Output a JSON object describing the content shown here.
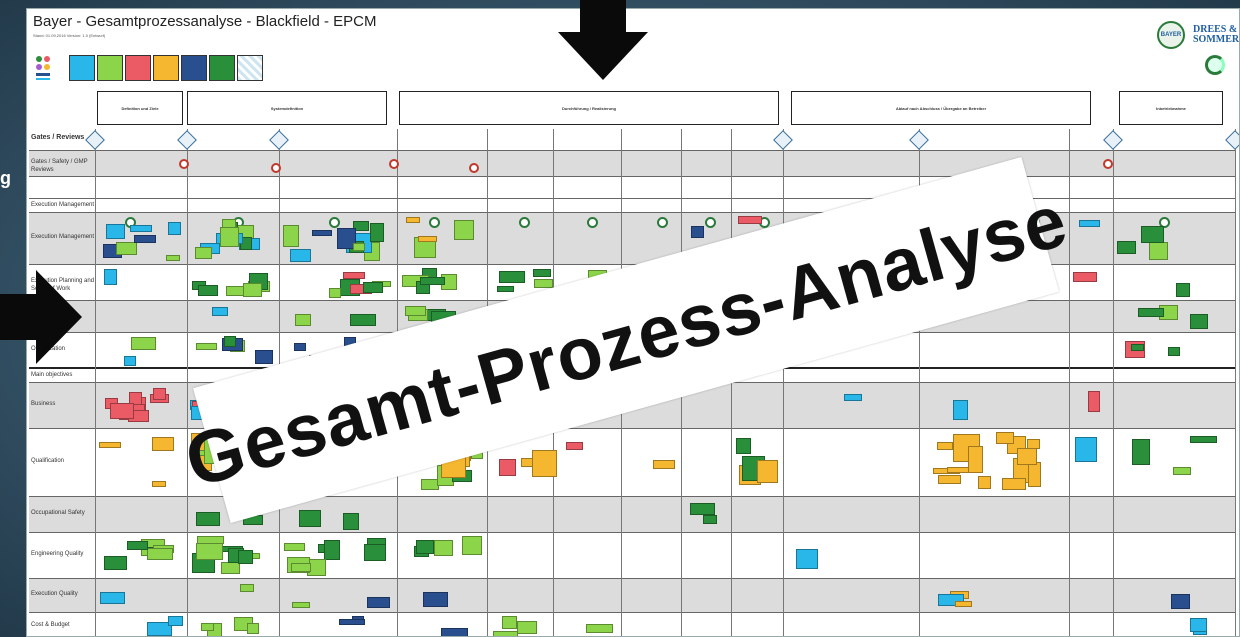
{
  "left_fragment": "g",
  "poster": {
    "title": "Bayer - Gesamtprozessanalyse - Blackfield - EPCM",
    "subtitle": "Stand: 01.09.2016 Version: 1.0 (Entwurf)",
    "legend_colors": [
      "#29b6e8",
      "#8cd44a",
      "#ea5b66",
      "#f5b730",
      "#2a4f8f",
      "#2a8f3a"
    ],
    "phases": [
      "Definition und Ziele",
      "Systemdefinition",
      "Durchführung / Realisierung",
      "Ablauf nach Abschluss / Übergabe an Betreiber",
      "Inbetriebnahme"
    ],
    "rows": [
      {
        "label": "Gates / Reviews"
      },
      {
        "label": "Gates / Safety / GMP Reviews"
      },
      {
        "label": ""
      },
      {
        "label": "Execution Management"
      },
      {
        "label": "Execution Management"
      },
      {
        "label": "Execution Planning and Scope of Work"
      },
      {
        "label": ""
      },
      {
        "label": "Organization"
      },
      {
        "label": "Main objectives"
      },
      {
        "label": "Business"
      },
      {
        "label": "Qualification"
      },
      {
        "label": "Occupational Safety"
      },
      {
        "label": "Engineering Quality"
      },
      {
        "label": "Execution Quality"
      },
      {
        "label": "Cost & Budget"
      }
    ],
    "logo_bayer": "BAYER",
    "logo_ds": "DREES & SOMMER"
  },
  "banner": {
    "text": "Gesamt-Prozess-Analyse"
  }
}
